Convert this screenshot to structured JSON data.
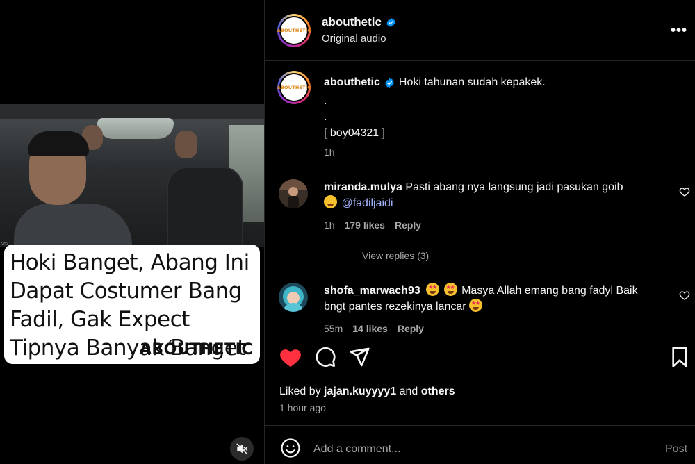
{
  "video": {
    "caption_overlay": "Hoki Banget, Abang Ini Dapat Costumer Bang Fadil, Gak Expect Tipnya Banyak Banget",
    "brand_overlay": "ABÓUTHETIC",
    "timestamp_overlay": "202",
    "mute_icon": "speaker-muted-icon"
  },
  "header": {
    "username": "abouthetic",
    "verified": true,
    "subtitle": "Original audio",
    "avatar_logo": "ABÓUTHETIC",
    "more_icon": "•••"
  },
  "caption": {
    "username": "abouthetic",
    "text": "Hoki tahunan sudah kepakek.",
    "line2": ".",
    "line3": ".",
    "line4": "[ boy04321 ]",
    "time": "1h"
  },
  "comments": [
    {
      "username": "miranda.mulya",
      "text": "Pasti abang nya langsung jadi pasukan goib",
      "mention": "@fadiljaidi",
      "emoji": "rolling-laughing-emoji",
      "time": "1h",
      "likes": "179 likes",
      "reply": "Reply"
    },
    {
      "username": "shofa_marwach93",
      "text_a": "Masya Allah emang bang fadyl Baik",
      "text_b": "bngt pantes rezekinya lancar",
      "emoji": "star-struck-emoji",
      "time": "55m",
      "likes": "14 likes",
      "reply": "Reply"
    }
  ],
  "view_replies": "View replies (3)",
  "actions": {
    "like_icon": "heart-filled-icon",
    "comment_icon": "comment-icon",
    "share_icon": "share-icon",
    "save_icon": "bookmark-icon",
    "like_color": "#ff3040"
  },
  "likes": {
    "prefix": "Liked by",
    "user": "jajan.kuyyyy1",
    "and": "and",
    "others": "others"
  },
  "time_ago": "1 hour ago",
  "comment_box": {
    "placeholder": "Add a comment...",
    "post_label": "Post"
  },
  "colors": {
    "background": "#000000",
    "text": "#f5f5f5",
    "muted": "#a8a8a8",
    "verified": "#0095f6",
    "mention": "#a5b4fc"
  }
}
